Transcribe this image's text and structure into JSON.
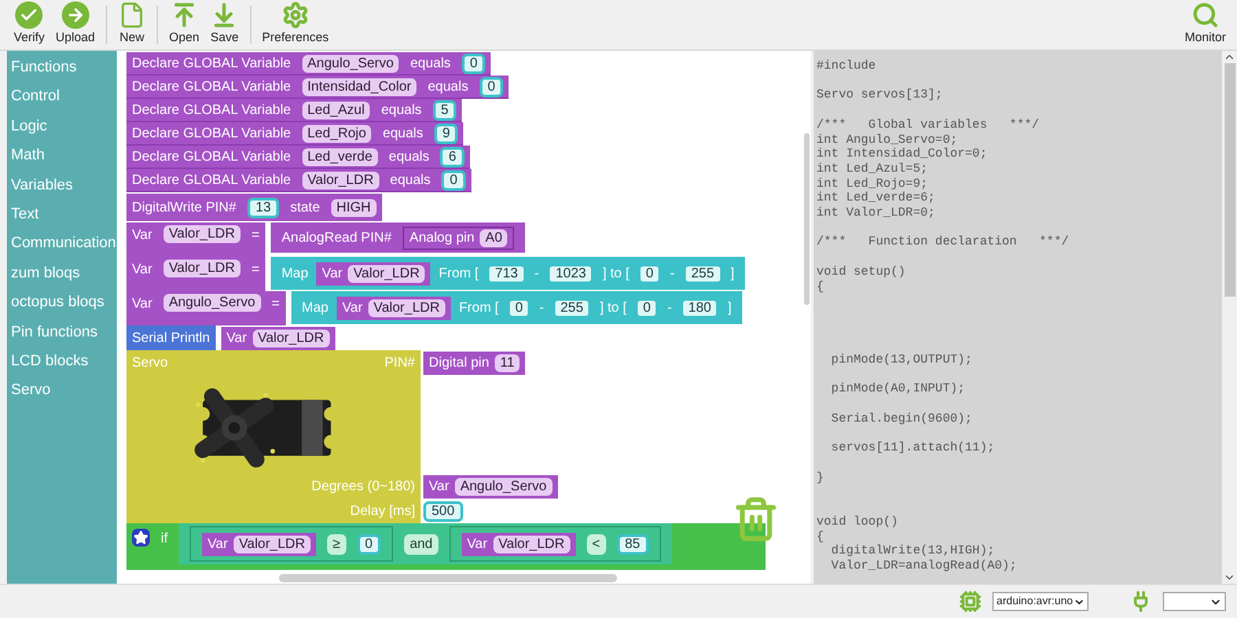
{
  "toolbar": {
    "buttons": [
      {
        "label": "Verify"
      },
      {
        "label": "Upload"
      },
      {
        "label": "New"
      },
      {
        "label": "Open"
      },
      {
        "label": "Save"
      },
      {
        "label": "Preferences"
      }
    ],
    "monitor": {
      "label": "Monitor"
    }
  },
  "sidebar": {
    "items": [
      "Functions",
      "Control",
      "Logic",
      "Math",
      "Variables",
      "Text",
      "Communication",
      "zum bloqs",
      "octopus bloqs",
      "Pin functions",
      "LCD blocks",
      "Servo"
    ]
  },
  "blocks": [
    {
      "kind": "declare",
      "label": "Declare GLOBAL Variable",
      "var": "Angulo_Servo",
      "equals": "equals",
      "value": "0"
    },
    {
      "kind": "declare",
      "label": "Declare GLOBAL Variable",
      "var": "Intensidad_Color",
      "equals": "equals",
      "value": "0"
    },
    {
      "kind": "declare",
      "label": "Declare GLOBAL Variable",
      "var": "Led_Azul",
      "equals": "equals",
      "value": "5"
    },
    {
      "kind": "declare",
      "label": "Declare GLOBAL Variable",
      "var": "Led_Rojo",
      "equals": "equals",
      "value": "9"
    },
    {
      "kind": "declare",
      "label": "Declare GLOBAL Variable",
      "var": "Led_verde",
      "equals": "equals",
      "value": "6"
    },
    {
      "kind": "declare",
      "label": "Declare GLOBAL Variable",
      "var": "Valor_LDR",
      "equals": "equals",
      "value": "0"
    },
    {
      "kind": "digitalwrite",
      "label": "DigitalWrite  PIN#",
      "pin": "13",
      "state_label": "state",
      "state": "HIGH"
    },
    {
      "kind": "assign",
      "var_label": "Var",
      "var": "Valor_LDR",
      "eq": "=",
      "expr": {
        "kind": "analogread",
        "label": "AnalogRead PIN#",
        "pin_label": "Analog pin",
        "pin": "A0"
      }
    },
    {
      "kind": "assign",
      "var_label": "Var",
      "var": "Valor_LDR",
      "eq": "=",
      "expr": {
        "kind": "map",
        "label": "Map",
        "var_label": "Var",
        "var": "Valor_LDR",
        "from": "From [",
        "a": "713",
        "dash1": "-",
        "b": "1023",
        "to": "] to [",
        "c": "0",
        "dash2": "-",
        "d": "255",
        "close": "]"
      }
    },
    {
      "kind": "assign",
      "var_label": "Var",
      "var": "Angulo_Servo",
      "eq": "=",
      "expr": {
        "kind": "map",
        "label": "Map",
        "var_label": "Var",
        "var": "Valor_LDR",
        "from": "From [",
        "a": "0",
        "dash1": "-",
        "b": "255",
        "to": "] to [",
        "c": "0",
        "dash2": "-",
        "d": "180",
        "close": "]"
      }
    },
    {
      "kind": "serial",
      "label": "Serial Println",
      "var_label": "Var",
      "var": "Valor_LDR"
    },
    {
      "kind": "servo",
      "label": "Servo",
      "pin_label": "PIN#",
      "pin_block": "Digital pin",
      "pin": "11",
      "degrees_label": "Degrees (0~180)",
      "var_label": "Var",
      "var": "Angulo_Servo",
      "delay_label": "Delay [ms]",
      "delay": "500"
    },
    {
      "kind": "if",
      "label": "if",
      "left": {
        "var_label": "Var",
        "var": "Valor_LDR",
        "op": "≥",
        "value": "0"
      },
      "join": "and",
      "right": {
        "var_label": "Var",
        "var": "Valor_LDR",
        "op": "<",
        "value": "85"
      }
    }
  ],
  "code": "#include\n\nServo servos[13];\n\n/***   Global variables   ***/\nint Angulo_Servo=0;\nint Intensidad_Color=0;\nint Led_Azul=5;\nint Led_Rojo=9;\nint Led_verde=6;\nint Valor_LDR=0;\n\n/***   Function declaration   ***/\n\nvoid setup()\n{\n\n\n\n\n  pinMode(13,OUTPUT);\n\n  pinMode(A0,INPUT);\n\n  Serial.begin(9600);\n\n  servos[11].attach(11);\n\n}\n\n\nvoid loop()\n{\n  digitalWrite(13,HIGH);\n  Valor_LDR=analogRead(A0);",
  "status_bar": {
    "board": "arduino:avr:uno"
  }
}
